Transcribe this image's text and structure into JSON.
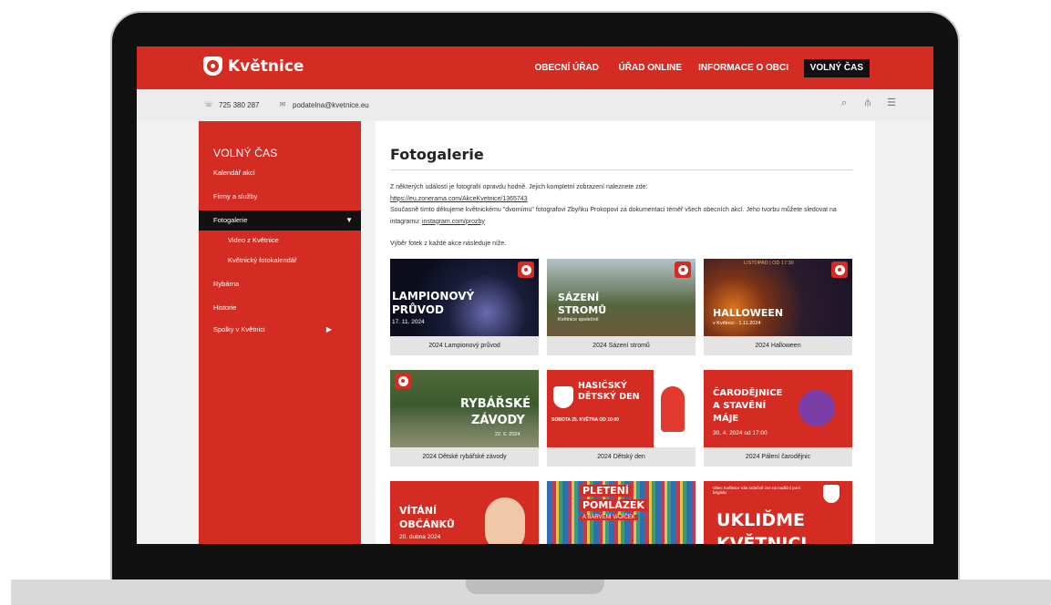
{
  "site": {
    "logo_text": "Květnice",
    "nav": [
      "OBECNÍ ÚŘAD",
      "ÚŘAD ONLINE",
      "INFORMACE O OBCI",
      "VOLNÝ ČAS"
    ],
    "phone": "725 380 287",
    "email": "podatelna@kvetnice.eu"
  },
  "sidebar": {
    "title": "VOLNÝ ČAS",
    "items": [
      {
        "label": "Kalendář akcí"
      },
      {
        "label": "Firmy a služby"
      },
      {
        "label": "Fotogalerie"
      },
      {
        "label": "Video z Květnice"
      },
      {
        "label": "Květnický fotokalendář"
      },
      {
        "label": "Rybárna"
      },
      {
        "label": "Historie"
      },
      {
        "label": "Spolky v Květnici"
      }
    ]
  },
  "content": {
    "title": "Fotogalerie",
    "intro_1": "Z některých událostí je fotografií opravdu hodně. Jejich kompletní zobrazení naleznete zde:",
    "link_1": "https://eu.zonerama.com/AkceKvetnice/1365743",
    "intro_2": "Současně tímto děkujeme květnickému \"dvornímu\" fotografovi Zbyňku Prokopovi za dokumentaci téměř všech obecních akcí. Jeho tvorbu můžete sledovat na intagramu:",
    "link_2": "instagram.com/prozby",
    "note": "Výběr fotek z každé akce následuje níže."
  },
  "gallery": [
    {
      "caption": "2024 Lampionový průvod",
      "t1": "LAMPIONOVÝ",
      "t2": "PRŮVOD",
      "t3": "17. 11. 2024"
    },
    {
      "caption": "2024 Sázení stromů",
      "t1": "SÁZENÍ",
      "t2": "STROMŮ",
      "t3": "Květnice společně"
    },
    {
      "caption": "2024 Halloween",
      "t1": "HALLOWEEN",
      "t2": "v Květnici - 1.11.2024",
      "t3": "LISTOPAD | OD 17:30"
    },
    {
      "caption": "2024 Dětské rybářské závody",
      "t1": "RYBÁŘSKÉ",
      "t2": "ZÁVODY",
      "t3": "22. 6. 2024"
    },
    {
      "caption": "2024 Dětský den",
      "t1": "HASIČSKÝ",
      "t2": "DĚTSKÝ DEN",
      "t3": "SOBOTA 25. KVĚTNA OD 10:00"
    },
    {
      "caption": "2024 Pálení čarodějnic",
      "t1": "ČARODĚJNICE",
      "t2": "A STAVĚNÍ",
      "t3": "MÁJE",
      "t4": "30. 4. 2024 od 17:00"
    },
    {
      "caption": "",
      "t1": "VÍTÁNÍ",
      "t2": "OBČÁNKŮ",
      "t3": "20. dubna 2024"
    },
    {
      "caption": "",
      "t1": "PLETENÍ",
      "t2": "POMLÁZEK",
      "t3": "A BARVENÍ VAJÍČEK"
    },
    {
      "caption": "",
      "t1": "UKLIĎME",
      "t2": "KVĚTNICI",
      "t3": "Obec Květnice Vás srdečně zve na tradiční jarní brigádu"
    }
  ],
  "colors": {
    "brand_red": "#d42c22",
    "dark": "#111111"
  }
}
